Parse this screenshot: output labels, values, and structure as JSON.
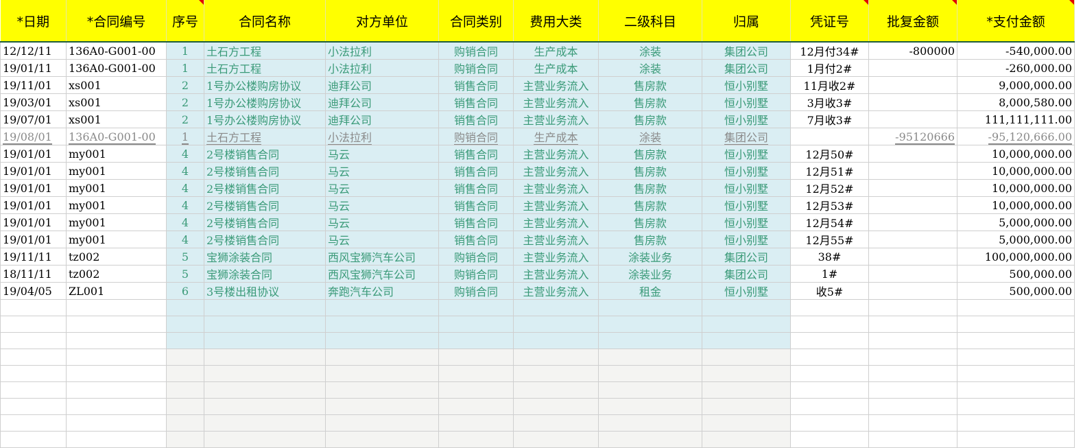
{
  "headers": [
    "*日期",
    "*合同编号",
    "序号",
    "合同名称",
    "对方单位",
    "合同类别",
    "费用大类",
    "二级科目",
    "归属",
    "凭证号",
    "批复金额",
    "*支付金额"
  ],
  "rows": [
    [
      "12/12/11",
      "136A0-G001-00",
      "1",
      "土石方工程",
      "小法拉利",
      "购销合同",
      "生产成本",
      "涂装",
      "集团公司",
      "12月付34#",
      "-800000",
      "-540,000.00"
    ],
    [
      "19/01/11",
      "136A0-G001-00",
      "1",
      "土石方工程",
      "小法拉利",
      "购销合同",
      "生产成本",
      "涂装",
      "集团公司",
      "1月付2#",
      "",
      "-260,000.00"
    ],
    [
      "19/11/01",
      "xs001",
      "2",
      "1号办公楼购房协议",
      "迪拜公司",
      "销售合同",
      "主营业务流入",
      "售房款",
      "恒小别墅",
      "11月收2#",
      "",
      "9,000,000.00"
    ],
    [
      "19/03/01",
      "xs001",
      "2",
      "1号办公楼购房协议",
      "迪拜公司",
      "销售合同",
      "主营业务流入",
      "售房款",
      "恒小别墅",
      "3月收3#",
      "",
      "8,000,580.00"
    ],
    [
      "19/07/01",
      "xs001",
      "2",
      "1号办公楼购房协议",
      "迪拜公司",
      "销售合同",
      "主营业务流入",
      "售房款",
      "恒小别墅",
      "7月收3#",
      "",
      "111,111,111.00"
    ],
    [
      "19/08/01",
      "136A0-G001-00",
      "1",
      "土石方工程",
      "小法拉利",
      "购销合同",
      "生产成本",
      "涂装",
      "集团公司",
      "",
      "-95120666",
      "-95,120,666.00"
    ],
    [
      "19/01/01",
      "my001",
      "4",
      "2号楼销售合同",
      "马云",
      "销售合同",
      "主营业务流入",
      "售房款",
      "恒小别墅",
      "12月50#",
      "",
      "10,000,000.00"
    ],
    [
      "19/01/01",
      "my001",
      "4",
      "2号楼销售合同",
      "马云",
      "销售合同",
      "主营业务流入",
      "售房款",
      "恒小别墅",
      "12月51#",
      "",
      "10,000,000.00"
    ],
    [
      "19/01/01",
      "my001",
      "4",
      "2号楼销售合同",
      "马云",
      "销售合同",
      "主营业务流入",
      "售房款",
      "恒小别墅",
      "12月52#",
      "",
      "10,000,000.00"
    ],
    [
      "19/01/01",
      "my001",
      "4",
      "2号楼销售合同",
      "马云",
      "销售合同",
      "主营业务流入",
      "售房款",
      "恒小别墅",
      "12月53#",
      "",
      "10,000,000.00"
    ],
    [
      "19/01/01",
      "my001",
      "4",
      "2号楼销售合同",
      "马云",
      "销售合同",
      "主营业务流入",
      "售房款",
      "恒小别墅",
      "12月54#",
      "",
      "5,000,000.00"
    ],
    [
      "19/01/01",
      "my001",
      "4",
      "2号楼销售合同",
      "马云",
      "销售合同",
      "主营业务流入",
      "售房款",
      "恒小别墅",
      "12月55#",
      "",
      "5,000,000.00"
    ],
    [
      "19/11/11",
      "tz002",
      "5",
      "宝狮涂装合同",
      "西风宝狮汽车公司",
      "购销合同",
      "主营业务流入",
      "涂装业务",
      "集团公司",
      "38#",
      "",
      "100,000,000.00"
    ],
    [
      "18/11/11",
      "tz002",
      "5",
      "宝狮涂装合同",
      "西风宝狮汽车公司",
      "购销合同",
      "主营业务流入",
      "涂装业务",
      "集团公司",
      "1#",
      "",
      "500,000.00"
    ],
    [
      "19/04/05",
      "ZL001",
      "6",
      "3号楼出租协议",
      "奔跑汽车公司",
      "购销合同",
      "主营业务流入",
      "租金",
      "恒小别墅",
      "收5#",
      "",
      "500,000.00"
    ]
  ],
  "gray_row": 5,
  "empty_blue_rows": 3,
  "empty_gray_rows": 6
}
